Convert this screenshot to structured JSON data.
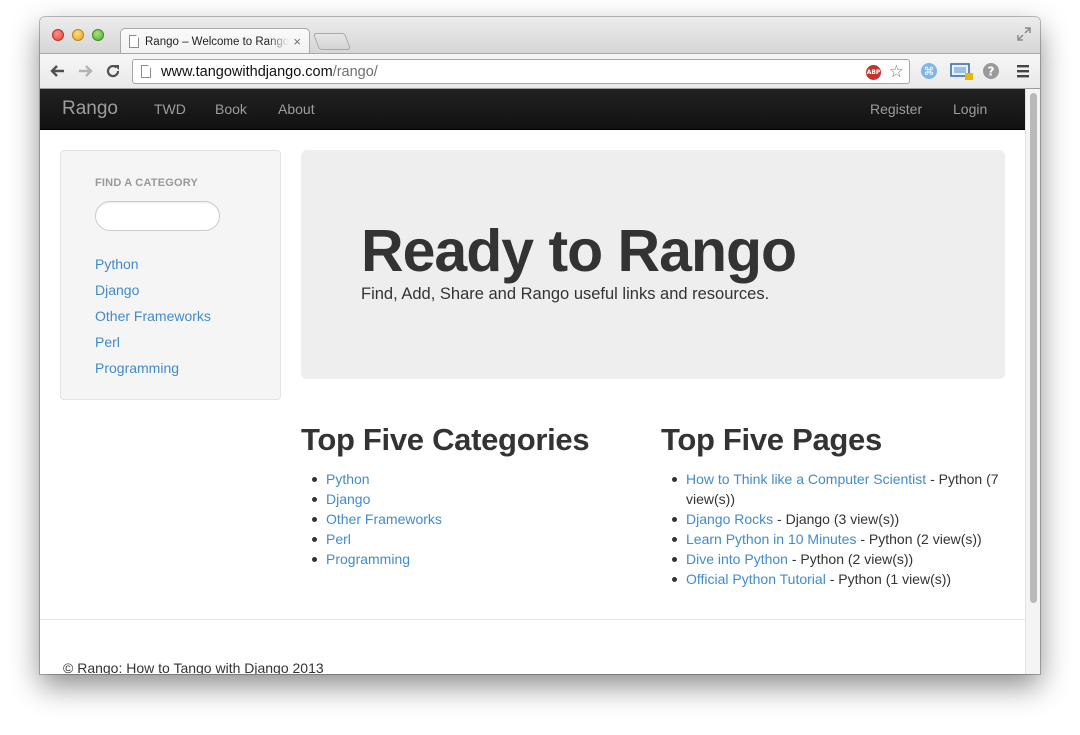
{
  "browser": {
    "tab_title": "Rango – Welcome to Rango",
    "tab_close": "×",
    "url_host": "www.tangowithdjango.com",
    "url_path": "/rango/",
    "abp_label": "ABP",
    "star": "☆"
  },
  "navbar": {
    "brand": "Rango",
    "links": [
      "TWD",
      "Book",
      "About"
    ],
    "right_links": [
      "Register",
      "Login"
    ]
  },
  "sidebar": {
    "header": "FIND A CATEGORY",
    "search_value": "",
    "categories": [
      "Python",
      "Django",
      "Other Frameworks",
      "Perl",
      "Programming"
    ]
  },
  "jumbotron": {
    "title": "Ready to Rango",
    "subtitle": "Find, Add, Share and Rango useful links and resources."
  },
  "top_categories": {
    "title": "Top Five Categories",
    "items": [
      "Python",
      "Django",
      "Other Frameworks",
      "Perl",
      "Programming"
    ]
  },
  "top_pages": {
    "title": "Top Five Pages",
    "items": [
      {
        "link": "How to Think like a Computer Scientist",
        "rest": " - Python (7",
        "rest2": "view(s))"
      },
      {
        "link": "Django Rocks",
        "rest": " - Django (3 view(s))"
      },
      {
        "link": "Learn Python in 10 Minutes",
        "rest": " - Python (2 view(s))"
      },
      {
        "link": "Dive into Python",
        "rest": " - Python (2 view(s))"
      },
      {
        "link": "Official Python Tutorial",
        "rest": " - Python (1 view(s))"
      }
    ]
  },
  "footer": {
    "text": "© Rango: How to Tango with Django 2013"
  },
  "colors": {
    "link": "#428bca",
    "navbar": "#222222",
    "jumbotron": "#eeeeee"
  }
}
